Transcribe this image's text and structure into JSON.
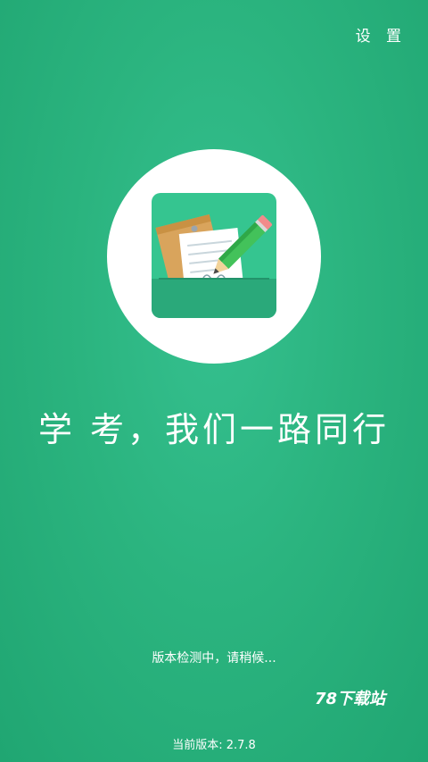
{
  "header": {
    "settings_label": "设 置"
  },
  "main": {
    "slogan": "学 考，我们一路同行",
    "status": "版本检测中，请稍候..."
  },
  "footer": {
    "watermark": "78下载站",
    "version": "当前版本: 2.7.8"
  },
  "colors": {
    "background": "#2bb47f",
    "icon_green": "#2fbf8a",
    "paper_tan": "#d8a45a",
    "pencil_green": "#43c25a",
    "pencil_eraser": "#f28b8b"
  }
}
